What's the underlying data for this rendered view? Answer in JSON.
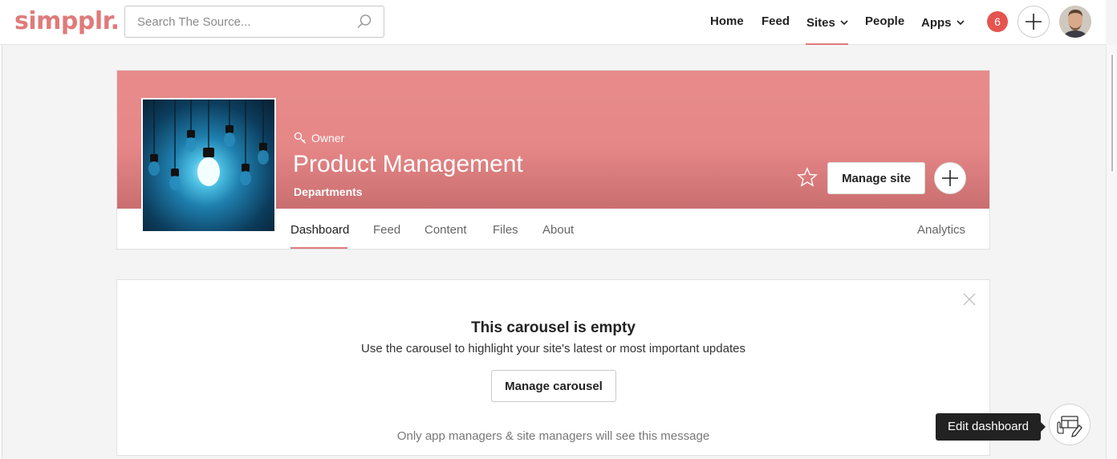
{
  "header": {
    "logo": "simpplr.",
    "search_placeholder": "Search The Source...",
    "nav": {
      "home": "Home",
      "feed": "Feed",
      "sites": "Sites",
      "people": "People",
      "apps": "Apps"
    },
    "notification_count": "6"
  },
  "site": {
    "role": "Owner",
    "name": "Product Management",
    "category": "Departments",
    "manage_label": "Manage site",
    "tabs": [
      "Dashboard",
      "Feed",
      "Content",
      "Files",
      "About"
    ],
    "analytics_label": "Analytics",
    "active_tab": "Dashboard"
  },
  "carousel": {
    "title": "This carousel is empty",
    "subtitle": "Use the carousel to highlight your site's latest or most important updates",
    "button_label": "Manage carousel",
    "note": "Only app managers & site managers will see this message"
  },
  "edit_dashboard": {
    "tooltip": "Edit dashboard"
  },
  "colors": {
    "brand": "#e07a7a",
    "cover": "#e68787",
    "badge": "#e5544f"
  }
}
